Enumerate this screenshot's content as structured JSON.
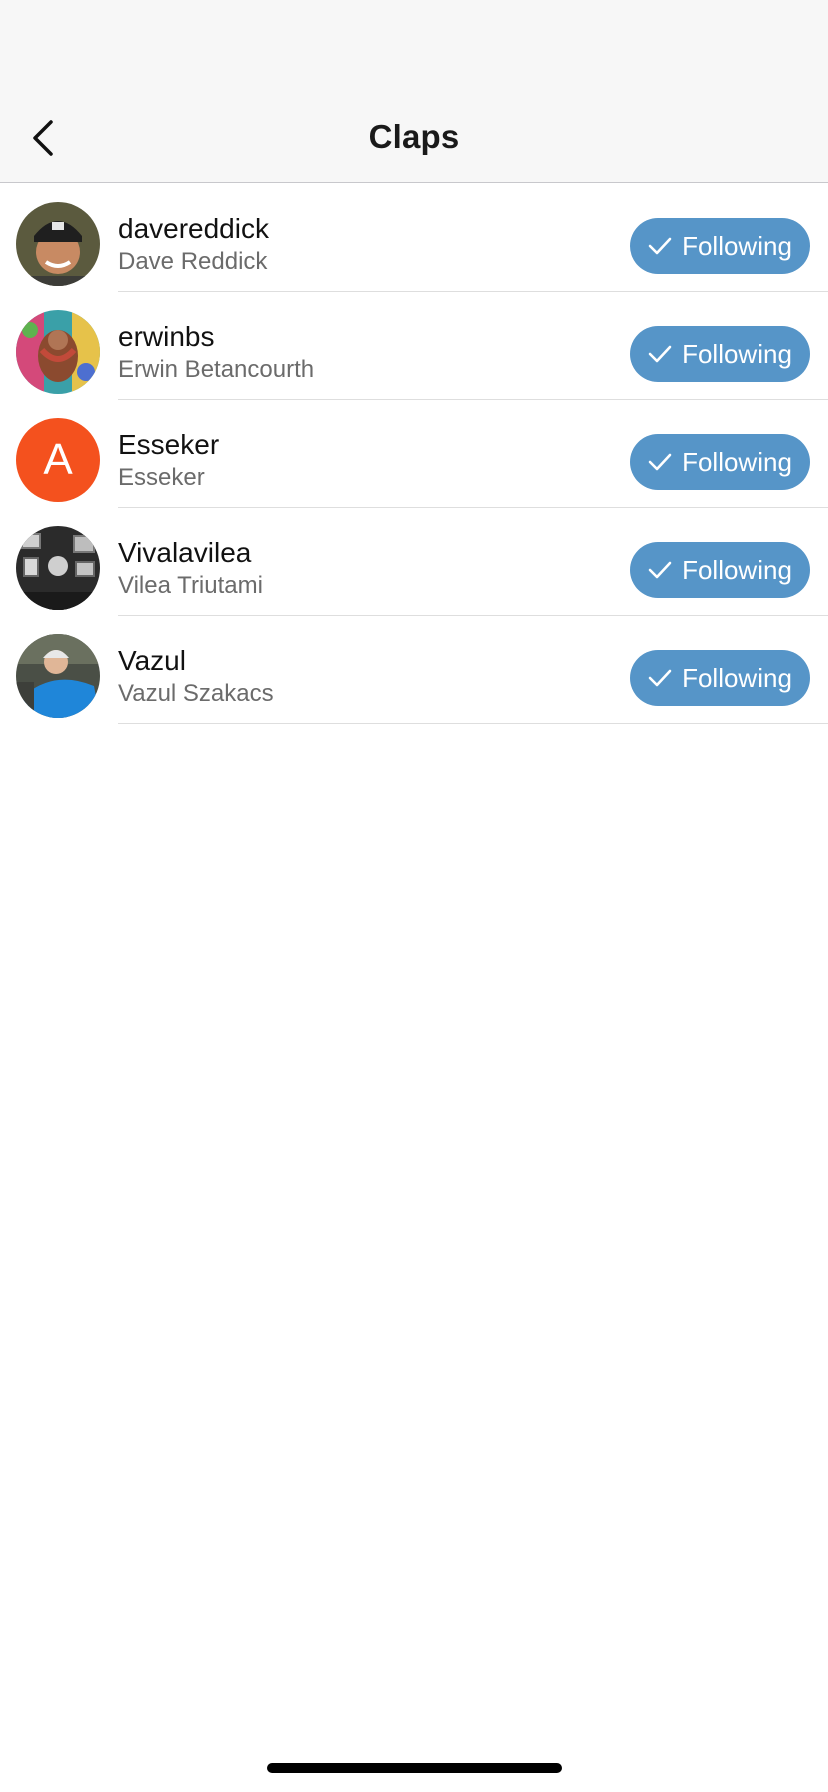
{
  "header": {
    "title": "Claps",
    "back_icon": "chevron-left-icon"
  },
  "users": [
    {
      "username": "davereddick",
      "full_name": "Dave Reddick",
      "button_label": "Following",
      "avatar": "photo"
    },
    {
      "username": "erwinbs",
      "full_name": "Erwin Betancourth",
      "button_label": "Following",
      "avatar": "photo"
    },
    {
      "username": "Esseker",
      "full_name": "Esseker",
      "button_label": "Following",
      "avatar_letter": "A",
      "avatar_color": "#f4511e"
    },
    {
      "username": "Vivalavilea",
      "full_name": "Vilea Triutami",
      "button_label": "Following",
      "avatar": "photo"
    },
    {
      "username": "Vazul",
      "full_name": "Vazul Szakacs",
      "button_label": "Following",
      "avatar": "photo"
    }
  ],
  "colors": {
    "button_bg": "#5695c8",
    "header_bg": "#f7f7f7"
  }
}
